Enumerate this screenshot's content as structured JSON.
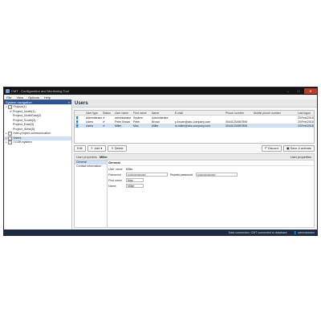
{
  "window": {
    "title": "CMT - Configuration and Monitoring Tool",
    "btn_min": "–",
    "btn_max": "□",
    "btn_close": "✕"
  },
  "menu": [
    "File",
    "View",
    "Options",
    "Help"
  ],
  "sidebar": {
    "title": "System navigation",
    "collapse": "«",
    "items": [
      {
        "label": "Project(1)",
        "expand": "▾"
      },
      {
        "label": "Project_North(1)",
        "expand": ""
      },
      {
        "label": "Project_NorthEast(2)",
        "expand": ""
      },
      {
        "label": "Project_South(3)",
        "expand": ""
      },
      {
        "label": "Project_East(4)",
        "expand": ""
      },
      {
        "label": "Project_West(5)",
        "expand": ""
      },
      {
        "label": "Inter-project communication",
        "expand": "▸"
      },
      {
        "label": "Users",
        "expand": "▸"
      },
      {
        "label": "TCSB system",
        "expand": "▸"
      }
    ]
  },
  "main": {
    "title": "Users",
    "grid": {
      "columns": [
        "",
        "User type",
        "Status",
        "User name",
        "First name",
        "Name",
        "E-mail",
        "Phone number",
        "Mobile phone number",
        "Last logon"
      ],
      "rows": [
        {
          "type": "Administrator",
          "status": "✔",
          "username": "administrator",
          "first": "System",
          "name": "Administrator",
          "email": "",
          "phone": "",
          "mobile": "",
          "last": "20/Feb/2018 17:39:09"
        },
        {
          "type": "Users",
          "status": "✔",
          "username": "Peter Brown",
          "first": "Peter",
          "name": "Brown",
          "email": "p.brown@abc-company.com",
          "phone": "00441234567890",
          "mobile": "",
          "last": "20/Feb/2018 17:38:09"
        },
        {
          "type": "Users",
          "status": "✔",
          "username": "Miller",
          "first": "Max",
          "name": "Miller",
          "email": "m.miller@abc-company.com",
          "phone": "00441234567890",
          "mobile": "",
          "last": "20/Feb/2018 17:38:45"
        }
      ]
    },
    "toolbar": {
      "edit": "Edit",
      "add": "Add",
      "delete": "Delete",
      "discard": "Discard",
      "save_activate": "Save & activate"
    },
    "props": {
      "label": "User properties",
      "value": "Miller",
      "right_label": "User properties",
      "nav": [
        "General",
        "Contact information"
      ],
      "section": "General",
      "fields": {
        "username_label": "User name",
        "username_value": "Miller",
        "password_label": "Password",
        "password_value": "••••••••••••••••••",
        "repeat_label": "Repeat password",
        "repeat_value": "••••••••••••••••••",
        "firstname_label": "First name",
        "firstname_value": "Max",
        "name_label": "Name",
        "name_value": "Miller"
      }
    }
  },
  "status": {
    "connection": "Data connection: CMT connected to database",
    "user": "administrator"
  },
  "colors": {
    "titlebar": "#141414",
    "sidebar_header": "#2f5597",
    "selection": "#cfe0f7",
    "statusbar": "#1d2a44"
  }
}
